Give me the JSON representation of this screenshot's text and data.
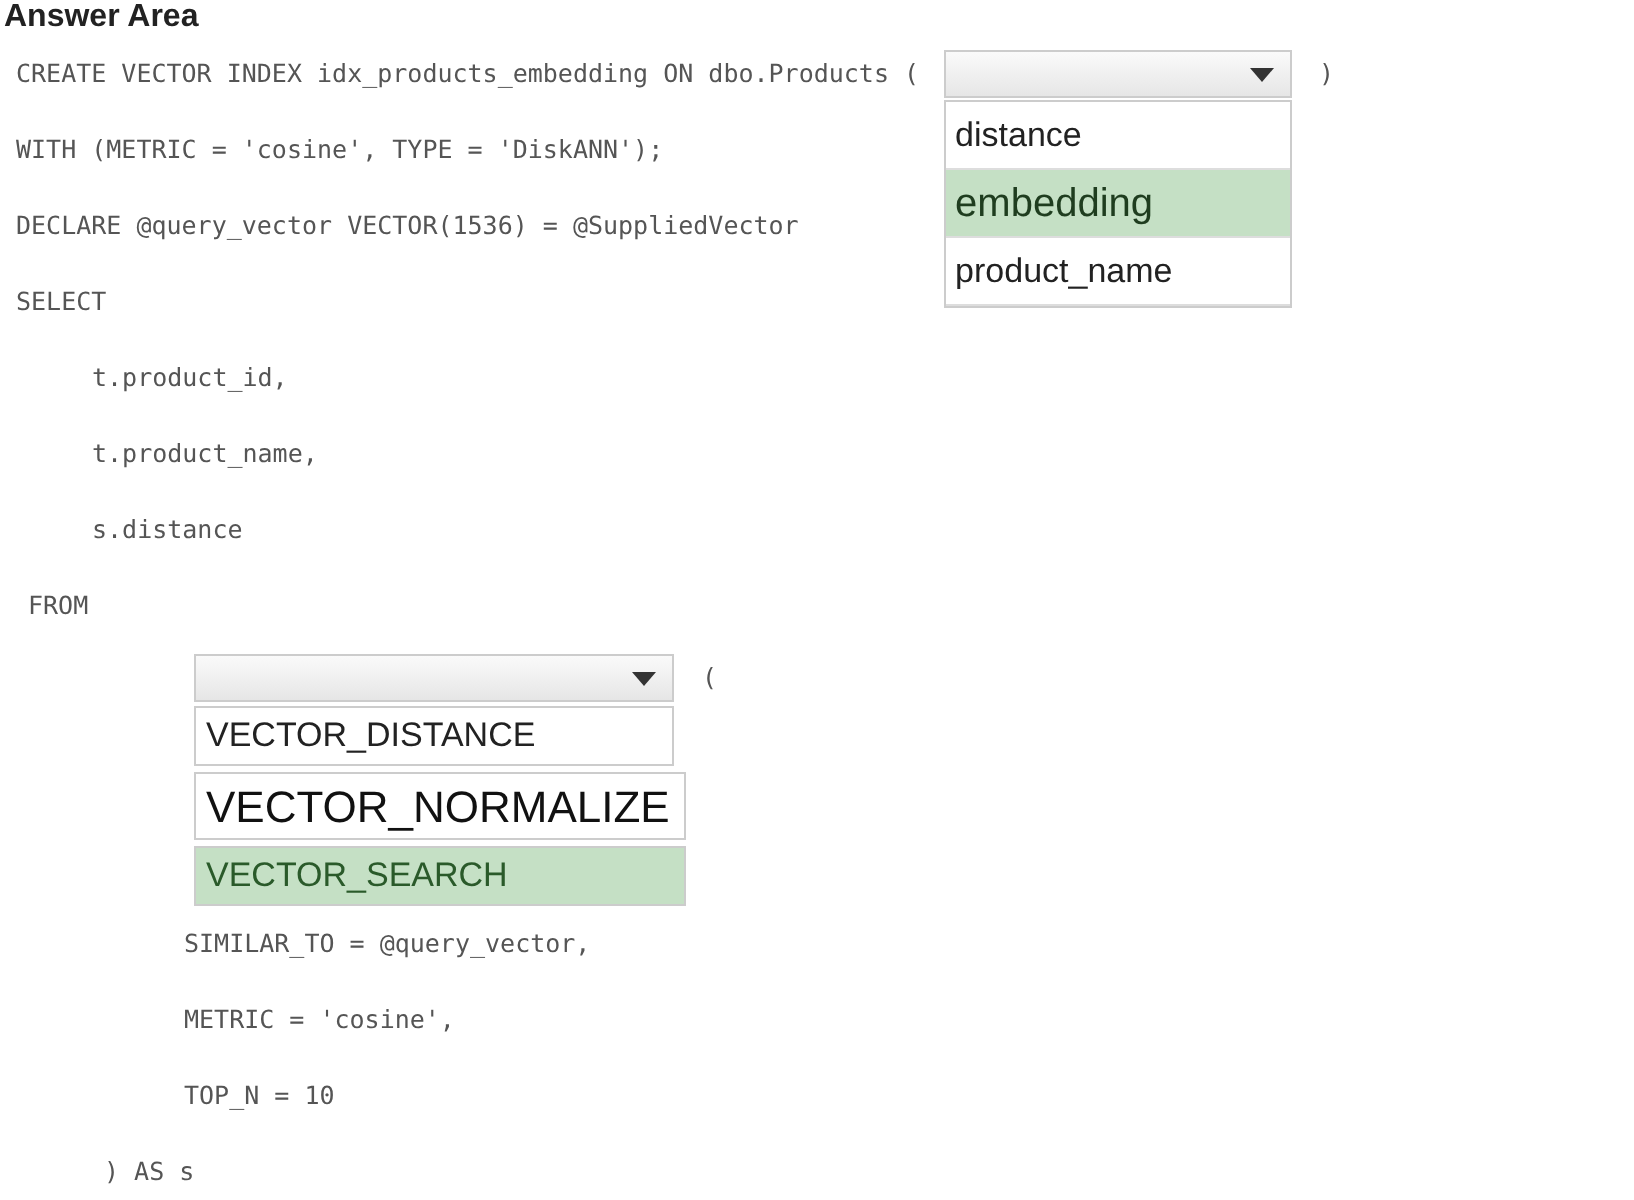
{
  "title": "Answer Area",
  "create_line": {
    "text": "CREATE VECTOR INDEX idx_products_embedding ON dbo.Products (",
    "closing": ")",
    "dropdown": {
      "expanded": true,
      "options": [
        {
          "label": "distance",
          "selected": false
        },
        {
          "label": "embedding",
          "selected": true
        },
        {
          "label": "product_name",
          "selected": false
        }
      ]
    }
  },
  "lines": [
    "WITH (METRIC = 'cosine', TYPE = 'DiskANN');",
    "DECLARE @query_vector VECTOR(1536) = @SuppliedVector",
    "SELECT"
  ],
  "select_columns": [
    "t.product_id,",
    "t.product_name,",
    "s.distance"
  ],
  "from_keyword": "FROM",
  "from_dropdown": {
    "expanded": true,
    "opening": "(",
    "options": [
      {
        "label": "VECTOR_DISTANCE",
        "selected": false
      },
      {
        "label": "VECTOR_NORMALIZE",
        "selected": false
      },
      {
        "label": "VECTOR_SEARCH",
        "selected": true
      }
    ]
  },
  "arguments": [
    "SIMILAR_TO = @query_vector,",
    "METRIC = 'cosine',",
    "TOP_N = 10"
  ],
  "closing_line": ") AS s"
}
